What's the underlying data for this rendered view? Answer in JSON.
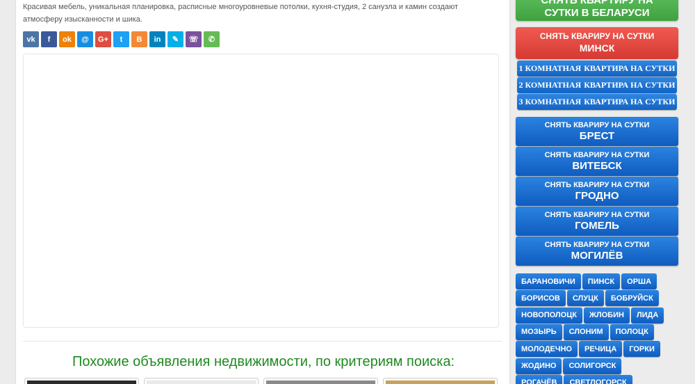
{
  "listing": {
    "description": "Красивая мебель, уникальная планировка, расписные многоуровневые потолки, кухня-студия, 2 санузла и камин создают атмосферу изысканности и шика."
  },
  "share_buttons": [
    {
      "icon": "vk-icon",
      "glyph": "vk",
      "color": "#4c75a3"
    },
    {
      "icon": "facebook-icon",
      "glyph": "f",
      "color": "#3b5998"
    },
    {
      "icon": "odnoklassniki-icon",
      "glyph": "ok",
      "color": "#ee8208"
    },
    {
      "icon": "moimir-icon",
      "glyph": "@",
      "color": "#168de2"
    },
    {
      "icon": "google-plus-icon",
      "glyph": "G+",
      "color": "#dc4e41"
    },
    {
      "icon": "twitter-icon",
      "glyph": "t",
      "color": "#1da1f2"
    },
    {
      "icon": "blogger-icon",
      "glyph": "B",
      "color": "#f38936"
    },
    {
      "icon": "linkedin-icon",
      "glyph": "in",
      "color": "#0083be"
    },
    {
      "icon": "livejournal-icon",
      "glyph": "✎",
      "color": "#00b0ea"
    },
    {
      "icon": "viber-icon",
      "glyph": "☏",
      "color": "#7b519d"
    },
    {
      "icon": "whatsapp-icon",
      "glyph": "✆",
      "color": "#65bc54"
    }
  ],
  "similar": {
    "heading": "Похожие объявления недвижимости, по критериям поиска:"
  },
  "sidebar": {
    "belarus": {
      "line1": "СНЯТЬ КВАРТИРУ НА",
      "line2": "СУТКИ В БЕЛАРУСИ"
    },
    "minsk": {
      "small": "СНЯТЬ КВАРИРУ НА СУТКИ",
      "big": "МИНСК"
    },
    "rooms": [
      {
        "count": "1 КОМНАТНАЯ",
        "label": "КВАРТИРА НА СУТКИ"
      },
      {
        "count": "2 КОМНАТНАЯ",
        "label": "КВАРТИРА НА СУТКИ"
      },
      {
        "count": "3 КОМНАТНАЯ",
        "label": "КВАРТИРА НА СУТКИ"
      }
    ],
    "cities": [
      {
        "small": "СНЯТЬ КВАРИРУ НА СУТКИ",
        "big": "БРЕСТ"
      },
      {
        "small": "СНЯТЬ КВАРИРУ НА СУТКИ",
        "big": "ВИТЕБСК"
      },
      {
        "small": "СНЯТЬ КВАРИРУ НА СУТКИ",
        "big": "ГРОДНО"
      },
      {
        "small": "СНЯТЬ КВАРИРУ НА СУТКИ",
        "big": "ГОМЕЛЬ"
      },
      {
        "small": "СНЯТЬ КВАРИРУ НА СУТКИ",
        "big": "МОГИЛЁВ"
      }
    ],
    "towns": [
      [
        "БАРАНОВИЧИ",
        "ПИНСК",
        "ОРША"
      ],
      [
        "БОРИСОВ",
        "СЛУЦК",
        "БОБРУЙСК"
      ],
      [
        "НОВОПОЛОЦК",
        "ЖЛОБИН",
        "ЛИДА"
      ],
      [
        "МОЗЫРЬ",
        "СЛОНИМ",
        "ПОЛОЦК"
      ],
      [
        "МОЛОДЕЧНО",
        "РЕЧИЦА",
        "ГОРКИ"
      ],
      [
        "ЖОДИНО",
        "СОЛИГОРСК"
      ],
      [
        "РОГАЧЁВ",
        "СВЕТЛОГОРСК"
      ]
    ]
  }
}
